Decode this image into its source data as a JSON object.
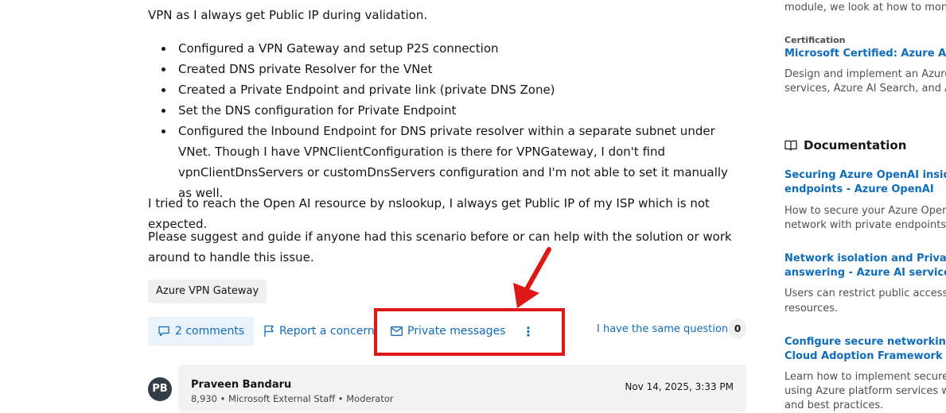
{
  "question": {
    "intro_line": "VPN as I always get Public IP during validation.",
    "steps": [
      "Configured a VPN Gateway and setup P2S connection",
      "Created DNS private Resolver for the VNet",
      "Created a Private Endpoint and private link (private DNS Zone)",
      "Set the DNS configuration for Private Endpoint",
      "Configured the Inbound Endpoint for DNS private resolver within a separate subnet under VNet. Though I have VPNClientConfiguration is there for VPNGateway, I don't find vpnClientDnsServers or customDnsServers configuration and I'm not able to set it manually as well."
    ],
    "paragraph_1": "I tried to reach the Open AI resource by nslookup, I always get Public IP of my ISP which is not expected.",
    "paragraph_2": "Please suggest and guide if anyone had this scenario before or can help with the solution or work around to handle this issue.",
    "tag": "Azure VPN Gateway"
  },
  "actions": {
    "comments_label": "2 comments",
    "report_label": "Report a concern",
    "private_messages_label": "Private messages",
    "more_label": "⋮",
    "same_question_label": "I have the same question",
    "same_question_count": "0"
  },
  "answer": {
    "avatar_initials": "PB",
    "author_name": "Praveen Bandaru",
    "author_meta": "8,930 • Microsoft External Staff • Moderator",
    "date": "Nov 14, 2025, 3:33 PM"
  },
  "sidebar": {
    "module_text": "module, we look at how to monit",
    "cert_eyebrow": "Certification",
    "cert_title": "Microsoft Certified: Azure AI Eng",
    "cert_desc_1": "Design and implement an Azure A",
    "cert_desc_2": "services, Azure AI Search, and Azu",
    "doc_heading": "Documentation",
    "docs": [
      {
        "title_1": "Securing Azure OpenAI inside a v",
        "title_2": "endpoints - Azure OpenAI",
        "desc_1": "How to secure your Azure OpenA",
        "desc_2": "network with private endpoints"
      },
      {
        "title_1": "Network isolation and Private Lin",
        "title_2": "answering - Azure AI services",
        "desc_1": "Users can restrict public access to",
        "desc_2": "resources."
      },
      {
        "title_1": "Configure secure networking for",
        "title_2": "Cloud Adoption Framework",
        "desc_1": "Learn how to implement secure n",
        "desc_2": "using Azure platform services wit",
        "desc_3": "and best practices."
      }
    ]
  },
  "colors": {
    "link": "#0f6cbd",
    "highlight": "#e01717",
    "avatar": "#333d47"
  }
}
